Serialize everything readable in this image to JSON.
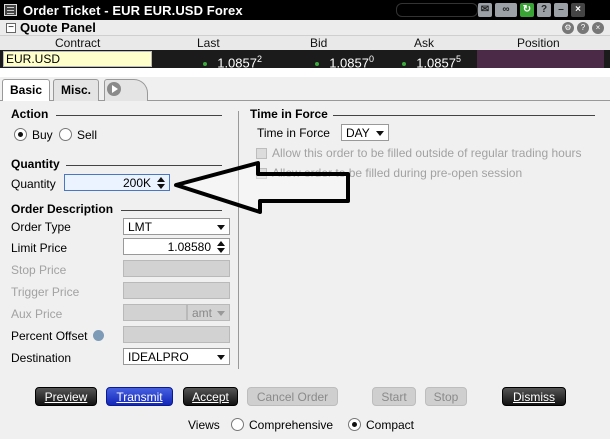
{
  "window": {
    "title": "Order Ticket - EUR EUR.USD Forex",
    "icons": [
      "link-icon",
      "chain-icon",
      "refresh-icon",
      "question-icon",
      "minimize-icon",
      "close-icon"
    ]
  },
  "quote_panel": {
    "title": "Quote Panel",
    "columns": [
      "Contract",
      "Last",
      "Bid",
      "Ask",
      "Position"
    ],
    "row": {
      "contract": "EUR.USD",
      "last_main": "1.0857",
      "last_pip": "2",
      "bid_main": "1.0857",
      "bid_pip": "0",
      "ask_main": "1.0857",
      "ask_pip": "5",
      "position": ""
    }
  },
  "tabs": {
    "basic": "Basic",
    "misc": "Misc."
  },
  "action": {
    "heading": "Action",
    "buy": "Buy",
    "sell": "Sell",
    "selected": "Buy"
  },
  "quantity": {
    "heading": "Quantity",
    "label": "Quantity",
    "value": "200K"
  },
  "order": {
    "heading": "Order Description",
    "order_type_label": "Order Type",
    "order_type": "LMT",
    "limit_price_label": "Limit Price",
    "limit_price": "1.08580",
    "stop_price_label": "Stop Price",
    "trigger_price_label": "Trigger Price",
    "aux_price_label": "Aux Price",
    "aux_unit": "amt",
    "percent_offset_label": "Percent Offset",
    "destination_label": "Destination",
    "destination": "IDEALPRO"
  },
  "tif": {
    "heading": "Time in Force",
    "label": "Time in Force",
    "value": "DAY",
    "option_outside_rth": "Allow this order to be filled outside of regular trading hours",
    "option_pre_open": "Allow order to be filled during pre-open session"
  },
  "buttons": {
    "preview": "Preview",
    "transmit": "Transmit",
    "accept": "Accept",
    "cancel_order": "Cancel Order",
    "start": "Start",
    "stop": "Stop",
    "dismiss": "Dismiss"
  },
  "views": {
    "label": "Views",
    "comprehensive": "Comprehensive",
    "compact": "Compact",
    "selected": "Compact"
  },
  "colors": {
    "title_bar": "#000000",
    "quote_row": "#1b1b1b",
    "contract_cell": "#ffffcc",
    "position_cell": "#4a2a46",
    "transmit_button": "#1226b8",
    "tick_dot": "#3caa3c"
  }
}
